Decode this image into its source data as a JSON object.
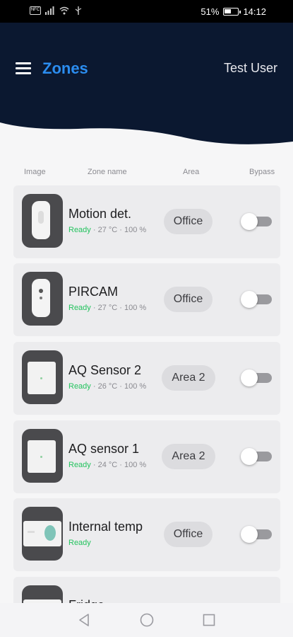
{
  "status_bar": {
    "nfc": "NFC",
    "battery": "51%",
    "battery_level": 0.51,
    "time": "14:12"
  },
  "header": {
    "title": "Zones",
    "user": "Test User",
    "bg_color": "#0b1830"
  },
  "columns": {
    "image": "Image",
    "zone_name": "Zone name",
    "area": "Area",
    "bypass": "Bypass"
  },
  "zones": [
    {
      "name": "Motion det.",
      "status": "Ready",
      "details": " · 27 °C · 100 %",
      "area": "Office",
      "bypass": false,
      "icon": "motion-detector-icon"
    },
    {
      "name": "PIRCAM",
      "status": "Ready",
      "details": " · 27 °C · 100 %",
      "area": "Office",
      "bypass": false,
      "icon": "pir-camera-icon"
    },
    {
      "name": "AQ Sensor 2",
      "status": "Ready",
      "details": " · 26 °C · 100 %",
      "area": "Area 2",
      "bypass": false,
      "icon": "air-quality-sensor-icon"
    },
    {
      "name": "AQ sensor 1",
      "status": "Ready",
      "details": " · 24 °C · 100 %",
      "area": "Area 2",
      "bypass": false,
      "icon": "air-quality-sensor-icon"
    },
    {
      "name": "Internal temp",
      "status": "Ready",
      "details": "",
      "area": "Office",
      "bypass": false,
      "icon": "temperature-sensor-icon"
    },
    {
      "name": "Fridge",
      "status": "",
      "details": "",
      "area": "",
      "bypass": false,
      "icon": "temperature-sensor-icon"
    }
  ],
  "nav": {
    "back": "back-icon",
    "home": "home-icon",
    "recents": "recents-icon"
  },
  "colors": {
    "accent": "#2b8df0",
    "ready": "#23c35e"
  }
}
